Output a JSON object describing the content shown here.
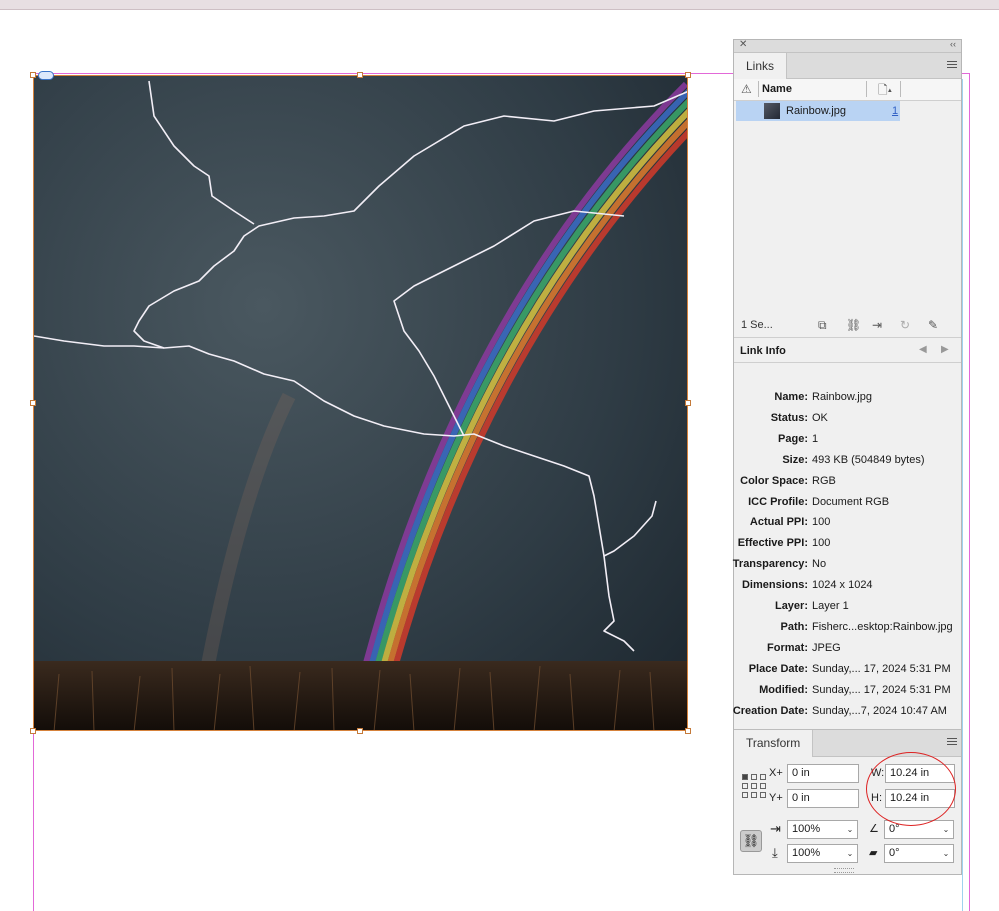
{
  "links_panel": {
    "tab_label": "Links",
    "col_name": "Name",
    "selected_link": {
      "name": "Rainbow.jpg",
      "page": "1"
    },
    "status_text": "1 Se...",
    "info_title": "Link Info",
    "info": [
      {
        "key": "Name:",
        "value": "Rainbow.jpg"
      },
      {
        "key": "Status:",
        "value": "OK"
      },
      {
        "key": "Page:",
        "value": "1"
      },
      {
        "key": "Size:",
        "value": "493 KB (504849 bytes)"
      },
      {
        "key": "Color Space:",
        "value": "RGB"
      },
      {
        "key": "ICC Profile:",
        "value": "Document RGB"
      },
      {
        "key": "Actual PPI:",
        "value": "100"
      },
      {
        "key": "Effective PPI:",
        "value": "100"
      },
      {
        "key": "Transparency:",
        "value": "No"
      },
      {
        "key": "Dimensions:",
        "value": "1024 x 1024"
      },
      {
        "key": "Layer:",
        "value": "Layer 1"
      },
      {
        "key": "Path:",
        "value": "Fisherc...esktop:Rainbow.jpg"
      },
      {
        "key": "Format:",
        "value": "JPEG"
      },
      {
        "key": "Place Date:",
        "value": "Sunday,... 17, 2024 5:31 PM"
      },
      {
        "key": "Modified:",
        "value": "Sunday,... 17, 2024 5:31 PM"
      },
      {
        "key": "Creation Date:",
        "value": "Sunday,...7, 2024 10:47 AM"
      }
    ]
  },
  "transform_panel": {
    "tab_label": "Transform",
    "x_label": "X+",
    "x_value": "0 in",
    "y_label": "Y+",
    "y_value": "0 in",
    "w_label": "W:",
    "w_value": "10.24 in",
    "h_label": "H:",
    "h_value": "10.24 in",
    "scale_x": "100%",
    "scale_y": "100%",
    "rotation": "0°",
    "shear": "0°"
  },
  "colors": {
    "accent_selection": "#b9d3f3",
    "annotation_circle": "#d22222",
    "frame_edge": "#d6823b"
  }
}
